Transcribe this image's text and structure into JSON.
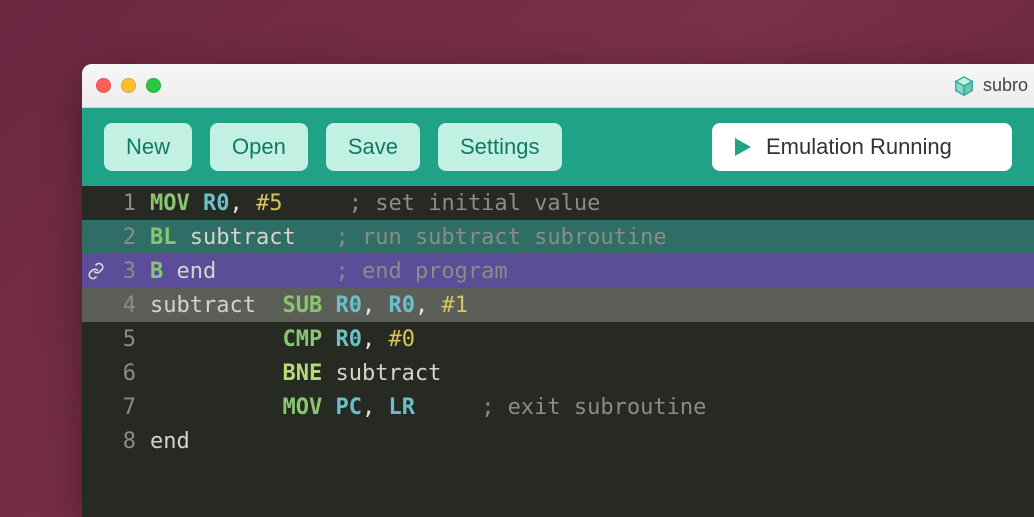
{
  "titlebar": {
    "title": "subro"
  },
  "toolbar": {
    "new_label": "New",
    "open_label": "Open",
    "save_label": "Save",
    "settings_label": "Settings"
  },
  "status": {
    "text": "Emulation Running"
  },
  "editor": {
    "lines": [
      {
        "no": "1",
        "mark": "",
        "highlight": "",
        "tokens": [
          {
            "t": "MOV",
            "cls": "mnemonic"
          },
          {
            "t": " ",
            "cls": "sp"
          },
          {
            "t": "R0",
            "cls": "reg"
          },
          {
            "t": ", ",
            "cls": "punct"
          },
          {
            "t": "#5",
            "cls": "num"
          },
          {
            "t": "     ",
            "cls": "sp"
          },
          {
            "t": "; set initial value",
            "cls": "comment"
          }
        ]
      },
      {
        "no": "2",
        "mark": "",
        "highlight": "teal",
        "tokens": [
          {
            "t": "BL",
            "cls": "mnemonic"
          },
          {
            "t": " ",
            "cls": "sp"
          },
          {
            "t": "subtract",
            "cls": "label"
          },
          {
            "t": "   ",
            "cls": "sp"
          },
          {
            "t": "; run subtract subroutine",
            "cls": "comment"
          }
        ]
      },
      {
        "no": "3",
        "mark": "link",
        "highlight": "purple",
        "tokens": [
          {
            "t": "B",
            "cls": "mnemonic"
          },
          {
            "t": " ",
            "cls": "sp"
          },
          {
            "t": "end",
            "cls": "label"
          },
          {
            "t": "         ",
            "cls": "sp"
          },
          {
            "t": "; end program",
            "cls": "comment"
          }
        ]
      },
      {
        "no": "4",
        "mark": "",
        "highlight": "gray",
        "tokens": [
          {
            "t": "subtract",
            "cls": "label"
          },
          {
            "t": "  ",
            "cls": "sp"
          },
          {
            "t": "SUB",
            "cls": "mnemonic"
          },
          {
            "t": " ",
            "cls": "sp"
          },
          {
            "t": "R0",
            "cls": "reg"
          },
          {
            "t": ", ",
            "cls": "punct"
          },
          {
            "t": "R0",
            "cls": "reg"
          },
          {
            "t": ", ",
            "cls": "punct"
          },
          {
            "t": "#1",
            "cls": "num"
          }
        ]
      },
      {
        "no": "5",
        "mark": "",
        "highlight": "",
        "tokens": [
          {
            "t": "          ",
            "cls": "sp"
          },
          {
            "t": "CMP",
            "cls": "mnemonic"
          },
          {
            "t": " ",
            "cls": "sp"
          },
          {
            "t": "R0",
            "cls": "reg"
          },
          {
            "t": ", ",
            "cls": "punct"
          },
          {
            "t": "#0",
            "cls": "num"
          }
        ]
      },
      {
        "no": "6",
        "mark": "",
        "highlight": "",
        "tokens": [
          {
            "t": "          ",
            "cls": "sp"
          },
          {
            "t": "BNE",
            "cls": "mnem-bne"
          },
          {
            "t": " ",
            "cls": "sp"
          },
          {
            "t": "subtract",
            "cls": "label"
          }
        ]
      },
      {
        "no": "7",
        "mark": "",
        "highlight": "",
        "tokens": [
          {
            "t": "          ",
            "cls": "sp"
          },
          {
            "t": "MOV",
            "cls": "mnemonic"
          },
          {
            "t": " ",
            "cls": "sp"
          },
          {
            "t": "PC",
            "cls": "reg"
          },
          {
            "t": ", ",
            "cls": "punct"
          },
          {
            "t": "LR",
            "cls": "reg"
          },
          {
            "t": "     ",
            "cls": "sp"
          },
          {
            "t": "; exit subroutine",
            "cls": "comment"
          }
        ]
      },
      {
        "no": "8",
        "mark": "",
        "highlight": "",
        "tokens": [
          {
            "t": "end",
            "cls": "label"
          }
        ]
      }
    ]
  }
}
